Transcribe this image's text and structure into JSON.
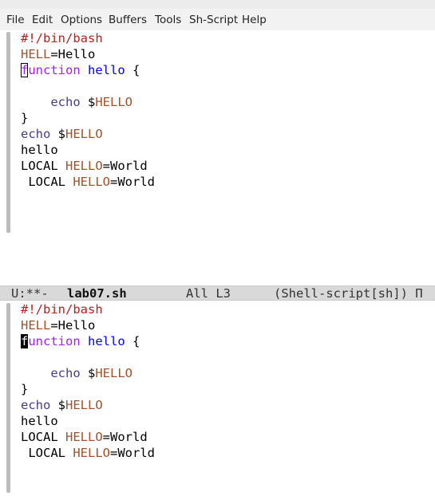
{
  "menu": {
    "items": [
      "File",
      "Edit",
      "Options",
      "Buffers",
      "Tools",
      "Sh-Script",
      "Help"
    ]
  },
  "editor": {
    "lines": [
      [
        {
          "t": "#!/bin/bash",
          "c": "comment"
        }
      ],
      [
        {
          "t": "HELL",
          "c": "var"
        },
        {
          "t": "=Hello",
          "c": "plain"
        }
      ],
      [
        {
          "t": "f",
          "c": "keyword",
          "cursor": true
        },
        {
          "t": "unction",
          "c": "keyword"
        },
        {
          "t": " ",
          "c": "plain"
        },
        {
          "t": "hello",
          "c": "func"
        },
        {
          "t": " {",
          "c": "plain"
        }
      ],
      [],
      [
        {
          "t": "    ",
          "c": "plain"
        },
        {
          "t": "echo",
          "c": "builtin"
        },
        {
          "t": " $",
          "c": "plain"
        },
        {
          "t": "HELLO",
          "c": "var"
        }
      ],
      [
        {
          "t": "}",
          "c": "plain"
        }
      ],
      [
        {
          "t": "echo",
          "c": "builtin"
        },
        {
          "t": " $",
          "c": "plain"
        },
        {
          "t": "HELLO",
          "c": "var"
        }
      ],
      [
        {
          "t": "hello",
          "c": "plain"
        }
      ],
      [
        {
          "t": "LOCAL ",
          "c": "plain"
        },
        {
          "t": "HELLO",
          "c": "var"
        },
        {
          "t": "=World",
          "c": "plain"
        }
      ],
      [
        {
          "t": " LOCAL ",
          "c": "plain"
        },
        {
          "t": "HELLO",
          "c": "var"
        },
        {
          "t": "=World",
          "c": "plain"
        }
      ]
    ]
  },
  "modeline": {
    "status": "U:**-",
    "buffer_name": "lab07.sh",
    "position": "All L3",
    "mode": "(Shell-script[sh]) П"
  },
  "colors": {
    "comment": "#b22222",
    "keyword": "#a020f0",
    "function_name": "#0000ff",
    "variable": "#a0522d",
    "builtin": "#483d8b",
    "modeline_bg": "#d9d9d9",
    "menubar_bg": "#f2f2f2"
  }
}
